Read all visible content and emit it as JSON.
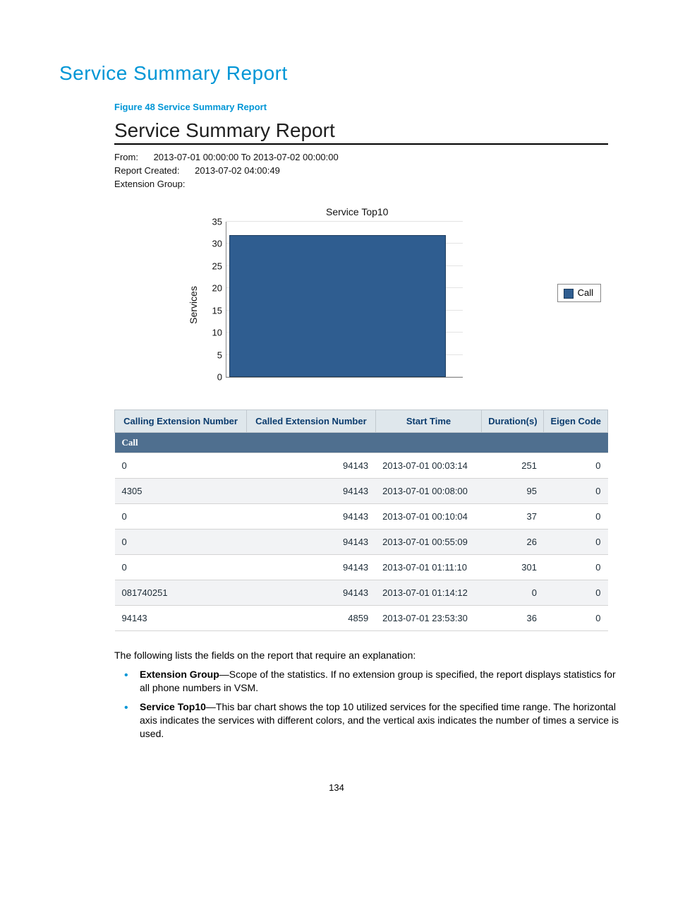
{
  "page_title": "Service Summary Report",
  "figure_caption": "Figure 48 Service Summary Report",
  "report": {
    "heading": "Service Summary Report",
    "from_label": "From:",
    "from_value": "2013-07-01 00:00:00  To   2013-07-02 00:00:00",
    "created_label": "Report Created:",
    "created_value": "2013-07-02 04:00:49",
    "extgroup_label": "Extension Group:",
    "extgroup_value": ""
  },
  "chart_data": {
    "type": "bar",
    "title": "Service Top10",
    "ylabel": "Services",
    "xlabel": "",
    "ylim": [
      0,
      35
    ],
    "yticks": [
      0,
      5,
      10,
      15,
      20,
      25,
      30,
      35
    ],
    "categories": [
      ""
    ],
    "series": [
      {
        "name": "Call",
        "values": [
          32
        ],
        "color": "#2f5d90"
      }
    ],
    "legend_position": "right"
  },
  "table": {
    "headers": [
      "Calling Extension Number",
      "Called Extension Number",
      "Start Time",
      "Duration(s)",
      "Eigen Code"
    ],
    "section_label": "Call",
    "rows": [
      {
        "calling": "0",
        "called": "94143",
        "start": "2013-07-01 00:03:14",
        "dur": "251",
        "eigen": "0"
      },
      {
        "calling": "4305",
        "called": "94143",
        "start": "2013-07-01 00:08:00",
        "dur": "95",
        "eigen": "0"
      },
      {
        "calling": "0",
        "called": "94143",
        "start": "2013-07-01 00:10:04",
        "dur": "37",
        "eigen": "0"
      },
      {
        "calling": "0",
        "called": "94143",
        "start": "2013-07-01 00:55:09",
        "dur": "26",
        "eigen": "0"
      },
      {
        "calling": "0",
        "called": "94143",
        "start": "2013-07-01 01:11:10",
        "dur": "301",
        "eigen": "0"
      },
      {
        "calling": "081740251",
        "called": "94143",
        "start": "2013-07-01 01:14:12",
        "dur": "0",
        "eigen": "0"
      },
      {
        "calling": "94143",
        "called": "4859",
        "start": "2013-07-01 23:53:30",
        "dur": "36",
        "eigen": "0"
      }
    ]
  },
  "explain_intro": "The following lists the fields on the report that require an explanation:",
  "explain_items": [
    {
      "term": "Extension Group",
      "desc": "—Scope of the statistics. If no extension group is specified, the report displays statistics for all phone numbers in VSM."
    },
    {
      "term": "Service Top10",
      "desc": "—This bar chart shows the top 10 utilized services for the specified time range. The horizontal axis indicates the services with different colors, and the vertical axis indicates the number of times a service is used."
    }
  ],
  "page_number": "134"
}
